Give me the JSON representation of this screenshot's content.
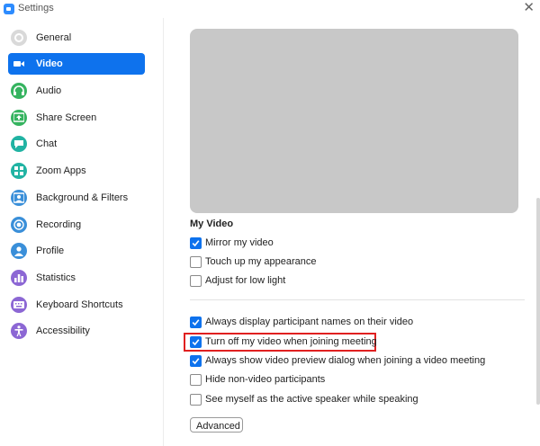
{
  "window": {
    "title": "Settings",
    "close_glyph": "✕"
  },
  "sidebar": {
    "items": [
      {
        "label": "General",
        "icon": "gear-icon",
        "color": "#d9d9d9",
        "active": false
      },
      {
        "label": "Video",
        "icon": "video-camera-icon",
        "color": "#ffffff",
        "active": true
      },
      {
        "label": "Audio",
        "icon": "headphones-icon",
        "color": "#35b35f",
        "active": false
      },
      {
        "label": "Share Screen",
        "icon": "share-screen-icon",
        "color": "#35b35f",
        "active": false
      },
      {
        "label": "Chat",
        "icon": "chat-bubble-icon",
        "color": "#21b3a3",
        "active": false
      },
      {
        "label": "Zoom Apps",
        "icon": "zoom-apps-icon",
        "color": "#21b3a3",
        "active": false
      },
      {
        "label": "Background & Filters",
        "icon": "background-filters-icon",
        "color": "#3a8fd9",
        "active": false
      },
      {
        "label": "Recording",
        "icon": "recording-icon",
        "color": "#3a8fd9",
        "active": false
      },
      {
        "label": "Profile",
        "icon": "profile-icon",
        "color": "#3a8fd9",
        "active": false
      },
      {
        "label": "Statistics",
        "icon": "statistics-icon",
        "color": "#8c67d4",
        "active": false
      },
      {
        "label": "Keyboard Shortcuts",
        "icon": "keyboard-icon",
        "color": "#8c67d4",
        "active": false
      },
      {
        "label": "Accessibility",
        "icon": "accessibility-icon",
        "color": "#8c67d4",
        "active": false
      }
    ]
  },
  "main": {
    "section_title": "My Video",
    "my_video_options": [
      {
        "label": "Mirror my video",
        "checked": true
      },
      {
        "label": "Touch up my appearance",
        "checked": false
      },
      {
        "label": "Adjust for low light",
        "checked": false
      }
    ],
    "general_options": [
      {
        "label": "Always display participant names on their video",
        "checked": true
      },
      {
        "label": "Turn off my video when joining meeting",
        "checked": true
      },
      {
        "label": "Always show video preview dialog when joining a video meeting",
        "checked": true
      },
      {
        "label": "Hide non-video participants",
        "checked": false
      },
      {
        "label": "See myself as the active speaker while speaking",
        "checked": false
      }
    ],
    "advanced_label": "Advanced"
  },
  "colors": {
    "accent": "#0e72ed",
    "highlight": "#e02020",
    "preview": "#c8c8c8"
  }
}
